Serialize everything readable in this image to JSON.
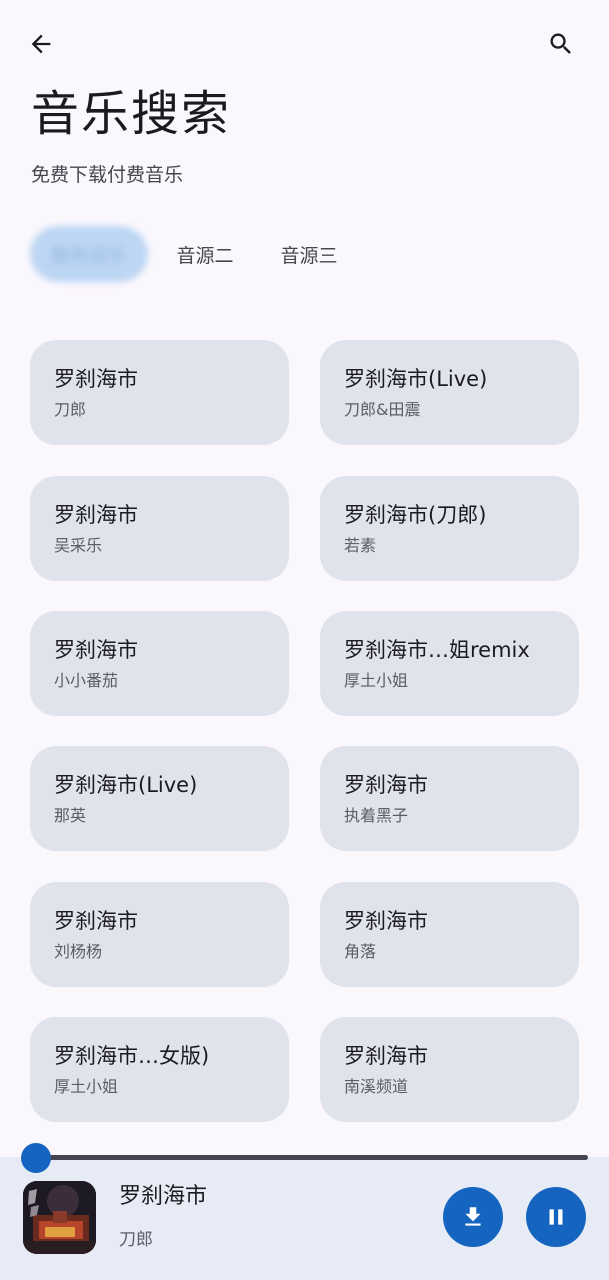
{
  "header": {
    "title": "音乐搜索",
    "subtitle": "免费下载付费音乐",
    "back_icon": "arrow-left-icon",
    "search_icon": "search-icon"
  },
  "tabs": [
    {
      "label": "酷狗音乐",
      "active": true
    },
    {
      "label": "音源二",
      "active": false
    },
    {
      "label": "音源三",
      "active": false
    }
  ],
  "songs": [
    {
      "title": "罗刹海市",
      "artist": "刀郎"
    },
    {
      "title": "罗刹海市(Live)",
      "artist": "刀郎&田震"
    },
    {
      "title": "罗刹海市",
      "artist": "吴采乐"
    },
    {
      "title": "罗刹海市(刀郎)",
      "artist": "若素"
    },
    {
      "title": "罗刹海市",
      "artist": "小小番茄"
    },
    {
      "title": "罗刹海市…姐remix",
      "artist": "厚土小姐"
    },
    {
      "title": "罗刹海市(Live)",
      "artist": "那英"
    },
    {
      "title": "罗刹海市",
      "artist": "执着黑子"
    },
    {
      "title": "罗刹海市",
      "artist": "刘杨杨"
    },
    {
      "title": "罗刹海市",
      "artist": "角落"
    },
    {
      "title": "罗刹海市…女版)",
      "artist": "厚土小姐"
    },
    {
      "title": "罗刹海市",
      "artist": "南溪频道"
    }
  ],
  "player": {
    "title": "罗刹海市",
    "artist": "刀郎",
    "progress": 0.0,
    "download_icon": "download-icon",
    "pause_icon": "pause-icon"
  },
  "colors": {
    "background": "#fbf8fd",
    "card": "#e0e2ec",
    "accent": "#1565c0",
    "player_bar": "#e6ebf6",
    "active_tab": "#bdd6f4"
  }
}
